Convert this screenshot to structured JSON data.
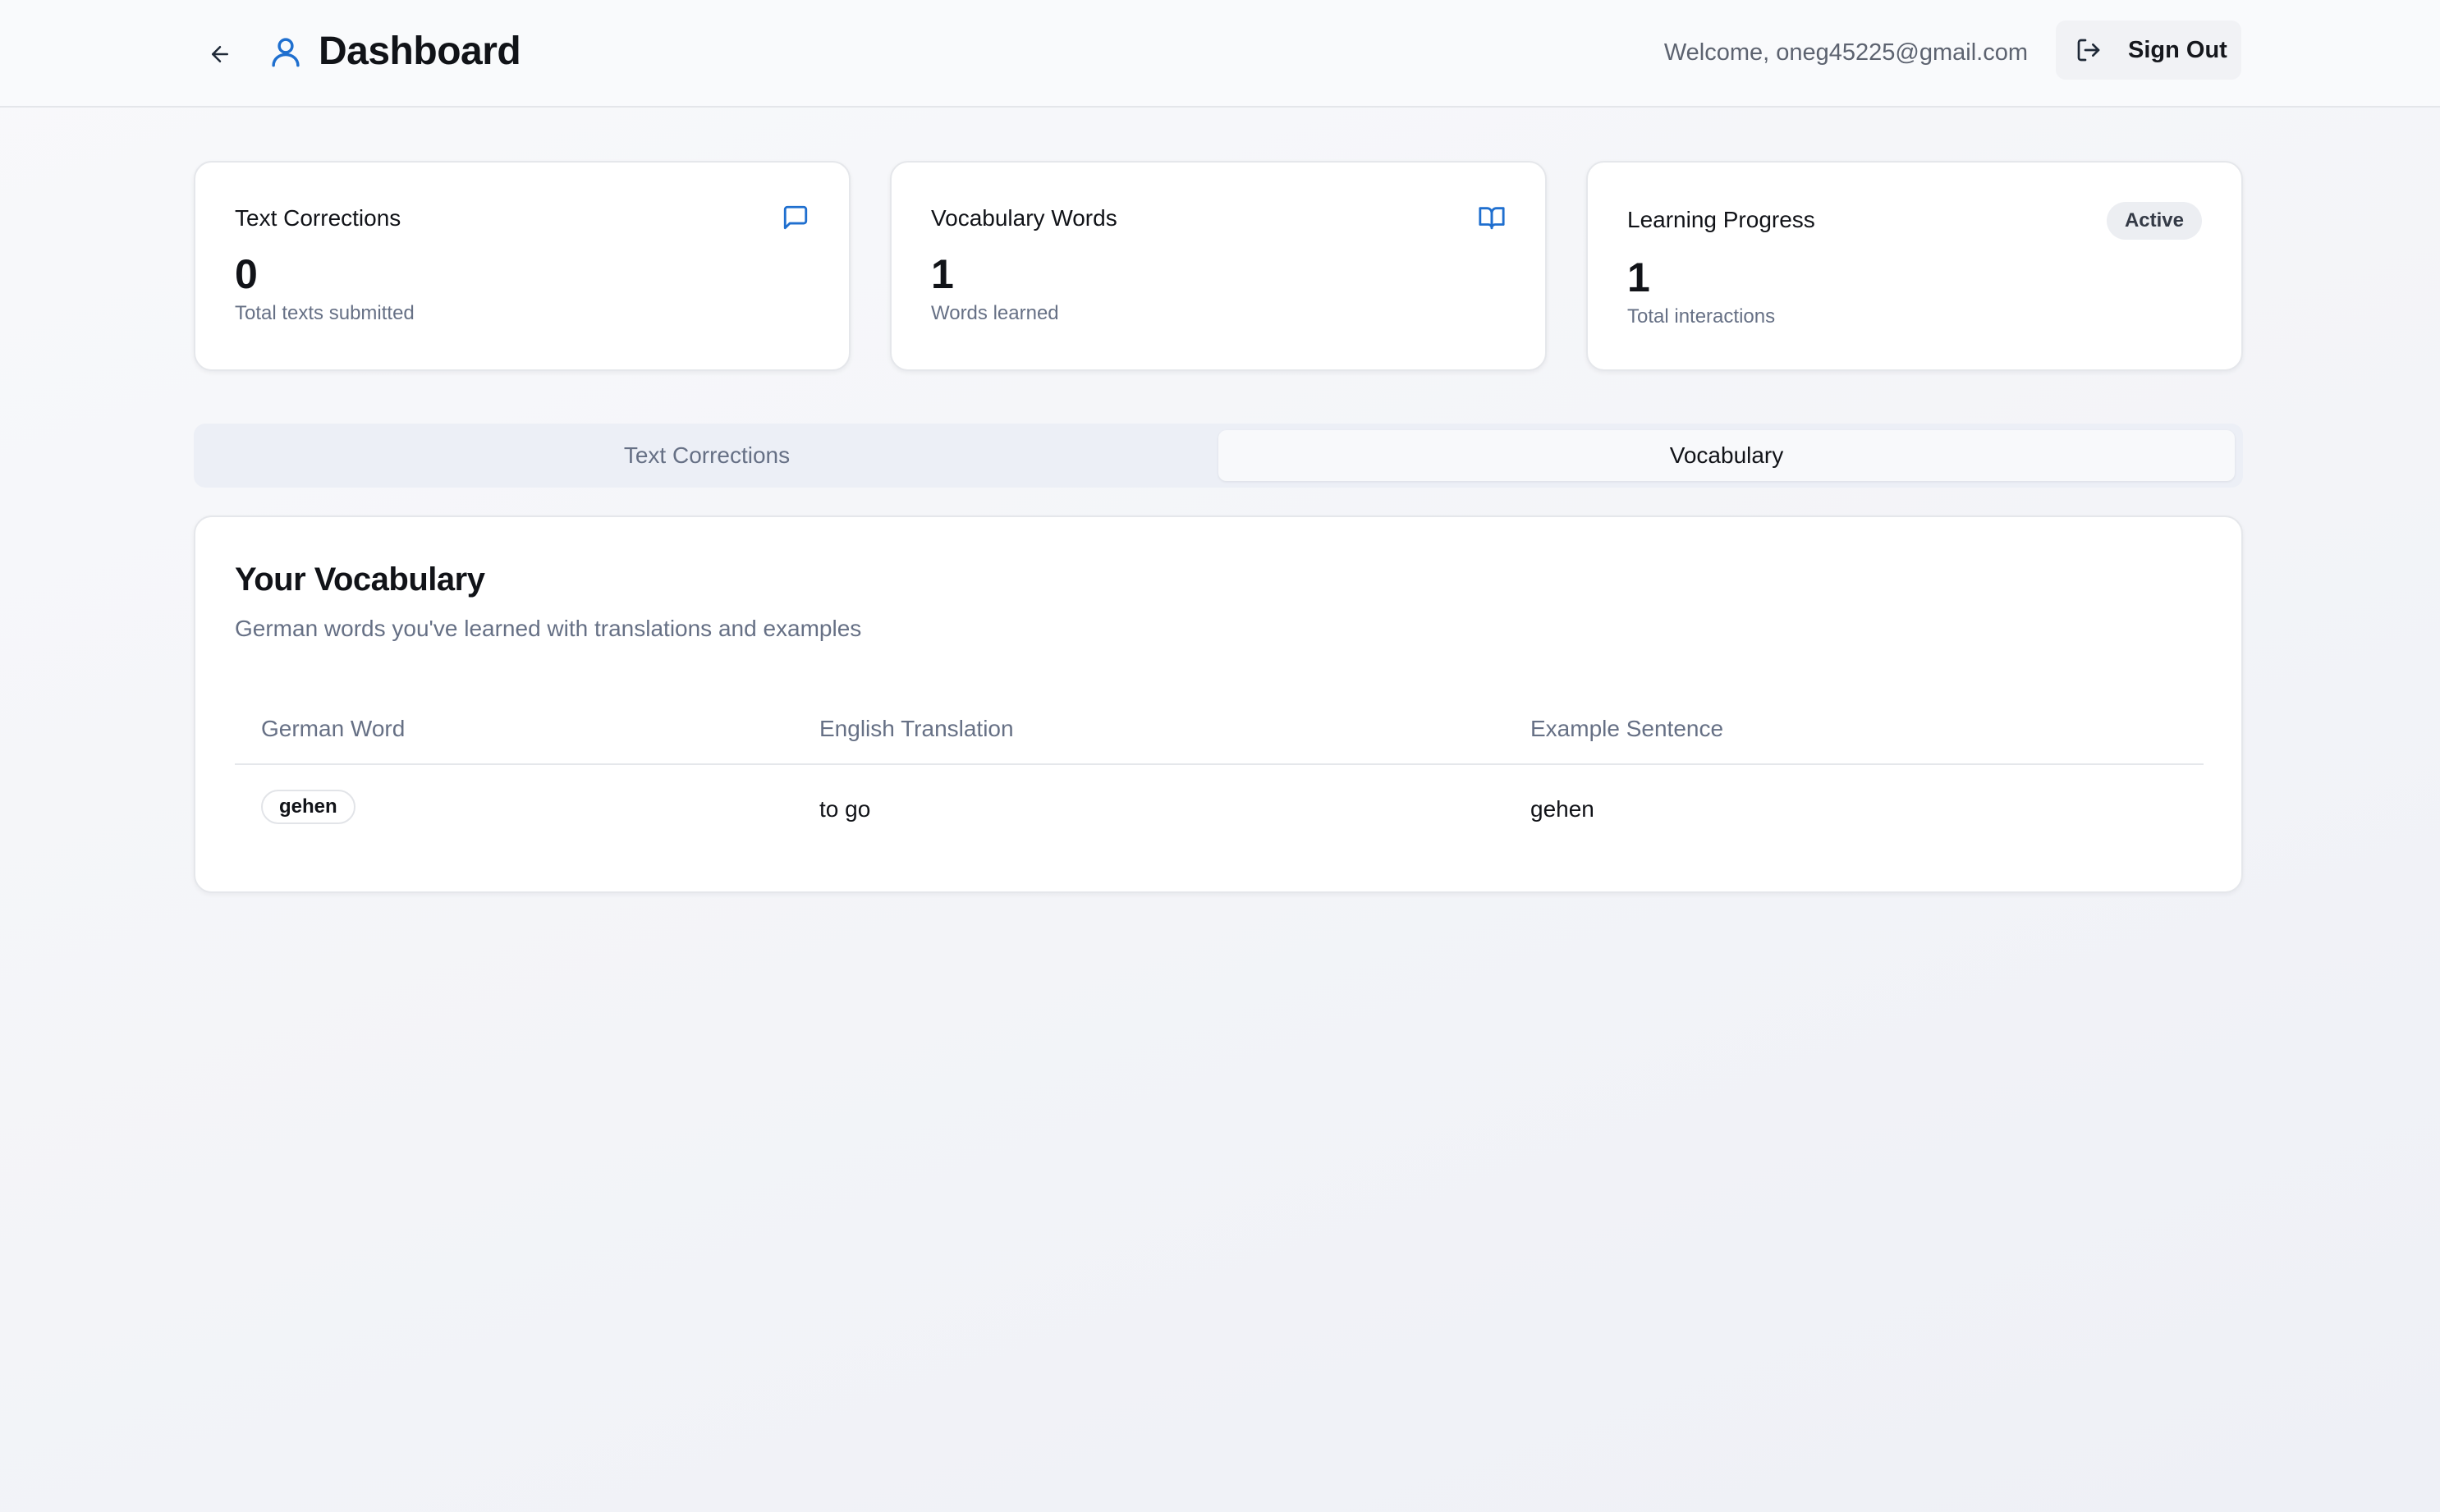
{
  "header": {
    "title": "Dashboard",
    "welcome_text": "Welcome, oneg45225@gmail.com",
    "signout_label": "Sign Out",
    "icons": {
      "back": "arrow-left-icon",
      "user": "user-icon",
      "signout": "log-out-icon"
    }
  },
  "stats": [
    {
      "title": "Text Corrections",
      "value": "0",
      "subtitle": "Total texts submitted",
      "icon": "message-square-icon"
    },
    {
      "title": "Vocabulary Words",
      "value": "1",
      "subtitle": "Words learned",
      "icon": "book-open-icon"
    },
    {
      "title": "Learning Progress",
      "value": "1",
      "subtitle": "Total interactions",
      "badge": "Active"
    }
  ],
  "tabs": [
    {
      "label": "Text Corrections",
      "active": false
    },
    {
      "label": "Vocabulary",
      "active": true
    }
  ],
  "vocabulary": {
    "title": "Your Vocabulary",
    "description": "German words you've learned with translations and examples",
    "columns": [
      "German Word",
      "English Translation",
      "Example Sentence"
    ],
    "rows": [
      {
        "german": "gehen",
        "english": "to go",
        "example": "gehen"
      }
    ]
  },
  "colors": {
    "accent": "#1f6fcf",
    "background": "#f4f5f8",
    "muted_text": "#667085",
    "card_border": "#e5e7eb"
  }
}
